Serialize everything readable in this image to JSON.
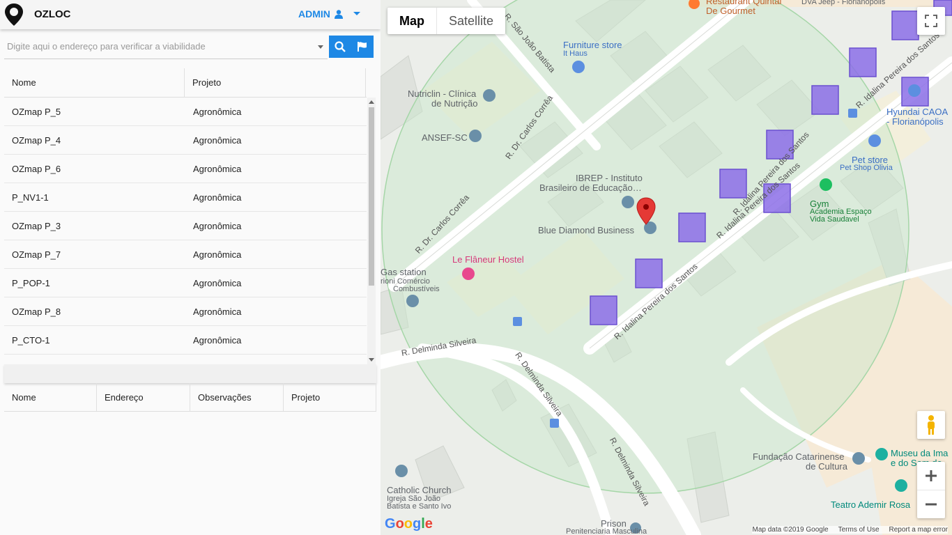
{
  "app": {
    "name": "OZLOC",
    "user_label": "ADMIN"
  },
  "search": {
    "placeholder": "Digite aqui o endereço para verificar a viabilidade"
  },
  "table1": {
    "headers": [
      "Nome",
      "Projeto"
    ],
    "rows": [
      [
        "OZmap P_5",
        "Agronômica"
      ],
      [
        "OZmap P_4",
        "Agronômica"
      ],
      [
        "OZmap P_6",
        "Agronômica"
      ],
      [
        "P_NV1-1",
        "Agronômica"
      ],
      [
        "OZmap P_3",
        "Agronômica"
      ],
      [
        "OZmap P_7",
        "Agronômica"
      ],
      [
        "P_POP-1",
        "Agronômica"
      ],
      [
        "OZmap P_8",
        "Agronômica"
      ],
      [
        "P_CTO-1",
        "Agronômica"
      ]
    ]
  },
  "table2": {
    "headers": [
      "Nome",
      "Endereço",
      "Observações",
      "Projeto"
    ]
  },
  "map": {
    "tabs": [
      "Map",
      "Satellite"
    ],
    "footer": {
      "data": "Map data ©2019 Google",
      "terms": "Terms of Use",
      "report": "Report a map error"
    },
    "labels": {
      "furniture": "Furniture store",
      "furniture_sub": "It Haus",
      "nutriclin": "Nutriclin - Clínica",
      "nutriclin2": "de Nutrição",
      "ansef": "ANSEF-SC",
      "ibrep": "IBREP - Instituto",
      "ibrep2": "Brasileiro de Educação…",
      "bluediamond": "Blue Diamond Business",
      "hostel": "Le Flâneur Hostel",
      "gas": "Gas station",
      "gas2": "rioni Comércio",
      "gas3": "Combustíveis",
      "gym": "Gym",
      "gym2": "Academia Espaço",
      "gym3": "Vida Saudavel",
      "petstore": "Pet store",
      "petstore2": "Pet Shop Olivia",
      "hyundai": "Hyundai CAOA",
      "hyundai2": "- Florianópolis",
      "restaurant": "Restaurant Quintal",
      "restaurant2": "De Gourmet",
      "dva": "DVA Jeep - Florianópolis",
      "fundacao": "Fundação Catarinense",
      "fundacao2": "de Cultura",
      "museu": "Museu da Ima",
      "museu2": "e do Som de",
      "teatro": "Teatro Ademir Rosa",
      "church": "Catholic Church",
      "church2": "Igreja São João",
      "church3": "Batista e Santo Ivo",
      "prison": "Prison",
      "prison2": "Penitenciaria Masculina",
      "google": "Google"
    },
    "streets": {
      "s1": "R. São João Batista",
      "s2": "R. Dr. Carlos Corrêa",
      "s3": "R. Dr. Carlos Corrêa",
      "s4": "R. Idalina Pereira dos Santos",
      "s5": "R. Idalina Pereira dos Santos",
      "s6": "R. Idalina Pereira dos Santos",
      "s7": "R. Idalina Pereira dos Santos",
      "s8": "R. Delminda Silveira",
      "s9": "R. Delminda Silveira",
      "s10": "R. Delminda Silveira"
    },
    "colors": {
      "coverage": "#c8e6c9",
      "marker_fill": "#8c6fe8",
      "pin": "#e53935"
    }
  }
}
